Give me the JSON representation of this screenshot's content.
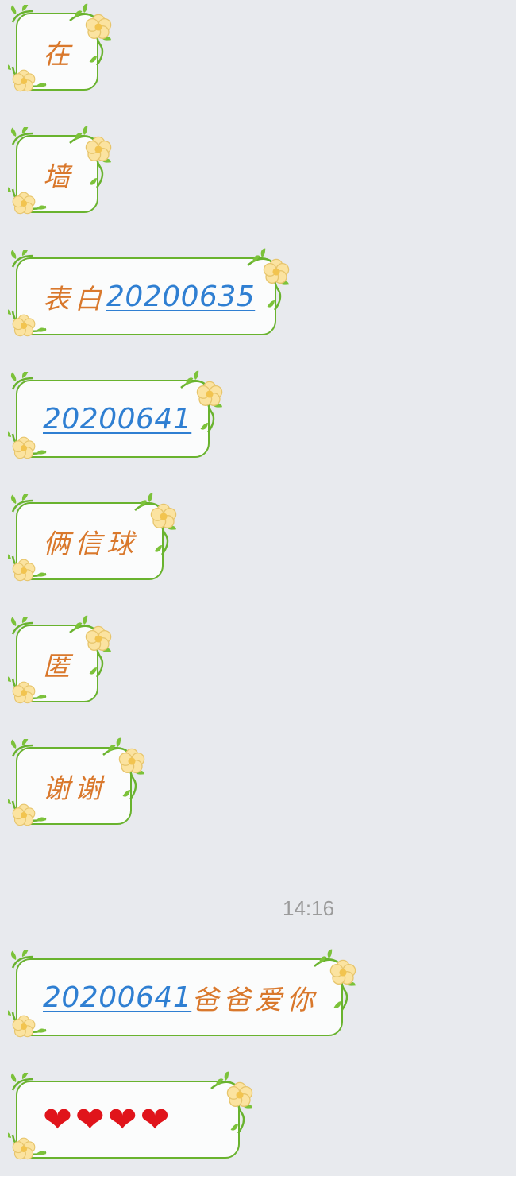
{
  "chat": {
    "messages": [
      {
        "id": "m1",
        "parts": [
          {
            "type": "text",
            "text": "在"
          }
        ]
      },
      {
        "id": "m2",
        "parts": [
          {
            "type": "text",
            "text": "墙"
          }
        ]
      },
      {
        "id": "m3",
        "parts": [
          {
            "type": "text",
            "text": "表白"
          },
          {
            "type": "link",
            "text": "20200635"
          }
        ]
      },
      {
        "id": "m4",
        "parts": [
          {
            "type": "link",
            "text": "20200641"
          }
        ]
      },
      {
        "id": "m5",
        "parts": [
          {
            "type": "text",
            "text": "俩信球"
          }
        ]
      },
      {
        "id": "m6",
        "parts": [
          {
            "type": "text",
            "text": "匿"
          }
        ]
      },
      {
        "id": "m7",
        "parts": [
          {
            "type": "text",
            "text": "谢谢"
          }
        ]
      },
      {
        "id": "m8",
        "parts": [
          {
            "type": "link",
            "text": "20200641"
          },
          {
            "type": "text",
            "text": "爸爸爱你"
          }
        ]
      },
      {
        "id": "m9",
        "parts": [
          {
            "type": "emoji",
            "text": "❤❤❤❤"
          }
        ]
      }
    ],
    "timestamp": "14:16"
  },
  "theme": {
    "chat_background": "#e8eaee",
    "bubble_border": "#69b32e",
    "bubble_fill": "#fbfcfc",
    "text_color": "#d9782c",
    "link_color": "#2f7fd2",
    "flower_color": "#fbe3a0",
    "heart_color": "#e0141b"
  },
  "icons": [
    "flower-vine-decoration",
    "heart-emoji"
  ]
}
